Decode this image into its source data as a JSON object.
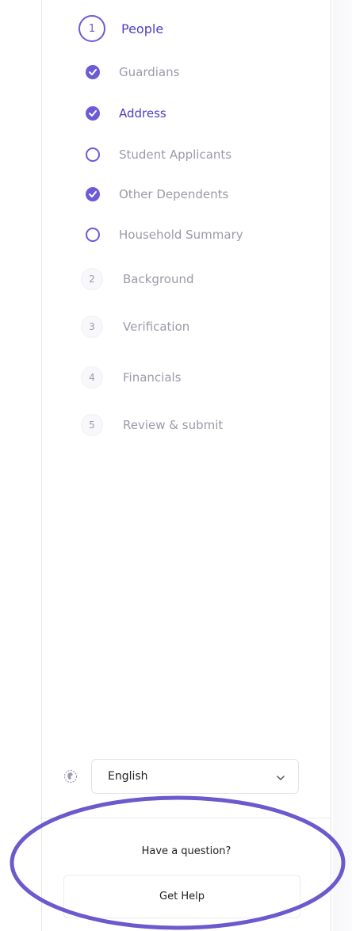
{
  "steps": {
    "step1": {
      "number": "1",
      "label": "People",
      "substeps": [
        {
          "label": "Guardians",
          "status": "complete"
        },
        {
          "label": "Address",
          "status": "complete-current"
        },
        {
          "label": "Student Applicants",
          "status": "incomplete"
        },
        {
          "label": "Other Dependents",
          "status": "complete"
        },
        {
          "label": "Household Summary",
          "status": "incomplete"
        }
      ]
    },
    "main": [
      {
        "number": "2",
        "label": "Background"
      },
      {
        "number": "3",
        "label": "Verification"
      },
      {
        "number": "4",
        "label": "Financials"
      },
      {
        "number": "5",
        "label": "Review & submit"
      }
    ]
  },
  "language": {
    "selected": "English",
    "icon": "globe-icon"
  },
  "help": {
    "question": "Have a question?",
    "button_label": "Get Help"
  },
  "colors": {
    "accent": "#6b5bd7",
    "annotation": "#6a5acd"
  }
}
